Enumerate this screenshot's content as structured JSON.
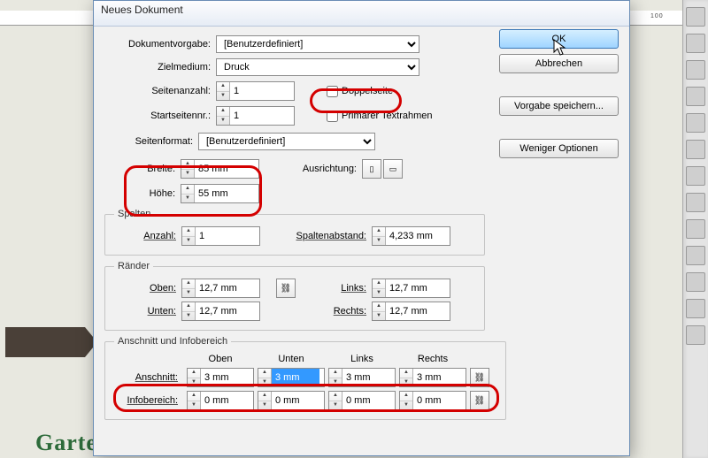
{
  "ruler_mark_100": "100",
  "bg_text": "Garten und Landschaftsbau",
  "dialog": {
    "title": "Neues Dokument",
    "preset_label": "Dokumentvorgabe:",
    "preset_value": "[Benutzerdefiniert]",
    "intent_label": "Zielmedium:",
    "intent_value": "Druck",
    "pages_label": "Seitenanzahl:",
    "pages_value": "1",
    "startpage_label": "Startseitennr.:",
    "startpage_value": "1",
    "facing_label": "Doppelseite",
    "primary_label": "Primärer Textrahmen",
    "pagesize_label": "Seitenformat:",
    "pagesize_value": "[Benutzerdefiniert]",
    "width_label": "Breite:",
    "width_value": "85 mm",
    "height_label": "Höhe:",
    "height_value": "55 mm",
    "orientation_label": "Ausrichtung:",
    "columns": {
      "legend": "Spalten",
      "count_label": "Anzahl:",
      "count_value": "1",
      "gutter_label": "Spaltenabstand:",
      "gutter_value": "4,233 mm"
    },
    "margins": {
      "legend": "Ränder",
      "top_label": "Oben:",
      "top_value": "12,7 mm",
      "bottom_label": "Unten:",
      "bottom_value": "12,7 mm",
      "left_label": "Links:",
      "left_value": "12,7 mm",
      "right_label": "Rechts:",
      "right_value": "12,7 mm"
    },
    "bleed": {
      "legend": "Anschnitt und Infobereich",
      "col_top": "Oben",
      "col_bottom": "Unten",
      "col_left": "Links",
      "col_right": "Rechts",
      "bleed_label": "Anschnitt:",
      "bleed_top": "3 mm",
      "bleed_bottom": "3 mm",
      "bleed_left": "3 mm",
      "bleed_right": "3 mm",
      "slug_label": "Infobereich:",
      "slug_top": "0 mm",
      "slug_bottom": "0 mm",
      "slug_left": "0 mm",
      "slug_right": "0 mm"
    },
    "buttons": {
      "ok": "OK",
      "cancel": "Abbrechen",
      "save_preset": "Vorgabe speichern...",
      "fewer": "Weniger Optionen"
    }
  }
}
